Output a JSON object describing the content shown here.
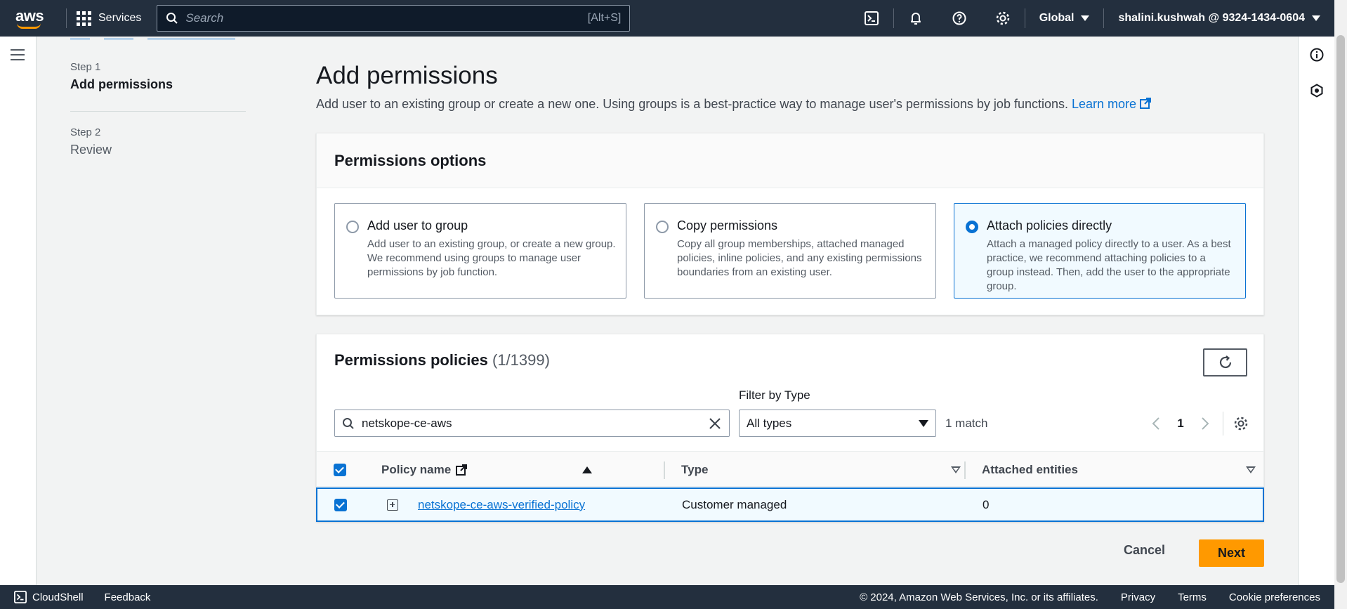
{
  "topnav": {
    "logo_text": "aws",
    "services_label": "Services",
    "search_placeholder": "Search",
    "search_shortcut": "[Alt+S]",
    "region": "Global",
    "account": "shalini.kushwah @ 9324-1434-0604"
  },
  "steps": [
    {
      "label": "Step 1",
      "title": "Add permissions"
    },
    {
      "label": "Step 2",
      "title": "Review"
    }
  ],
  "main": {
    "title": "Add permissions",
    "description": "Add user to an existing group or create a new one. Using groups is a best-practice way to manage user's permissions by job functions.",
    "learn_more": "Learn more"
  },
  "options": {
    "heading": "Permissions options",
    "tiles": [
      {
        "title": "Add user to group",
        "desc": "Add user to an existing group, or create a new group. We recommend using groups to manage user permissions by job function.",
        "selected": false
      },
      {
        "title": "Copy permissions",
        "desc": "Copy all group memberships, attached managed policies, inline policies, and any existing permissions boundaries from an existing user.",
        "selected": false
      },
      {
        "title": "Attach policies directly",
        "desc": "Attach a managed policy directly to a user. As a best practice, we recommend attaching policies to a group instead. Then, add the user to the appropriate group.",
        "selected": true
      }
    ]
  },
  "policies": {
    "heading": "Permissions policies",
    "count": "(1/1399)",
    "filter_label": "Filter by Type",
    "search_value": "netskope-ce-aws",
    "type_value": "All types",
    "match_text": "1 match",
    "page": "1",
    "columns": {
      "name": "Policy name",
      "type": "Type",
      "entities": "Attached entities"
    },
    "rows": [
      {
        "name": "netskope-ce-aws-verified-policy",
        "type": "Customer managed",
        "entities": "0"
      }
    ]
  },
  "actions": {
    "cancel": "Cancel",
    "next": "Next"
  },
  "footer": {
    "cloudshell": "CloudShell",
    "feedback": "Feedback",
    "copyright": "© 2024, Amazon Web Services, Inc. or its affiliates.",
    "privacy": "Privacy",
    "terms": "Terms",
    "cookies": "Cookie preferences"
  },
  "colors": {
    "nav": "#232f3e",
    "accent": "#0972d3",
    "primary_button": "#ff9900"
  }
}
